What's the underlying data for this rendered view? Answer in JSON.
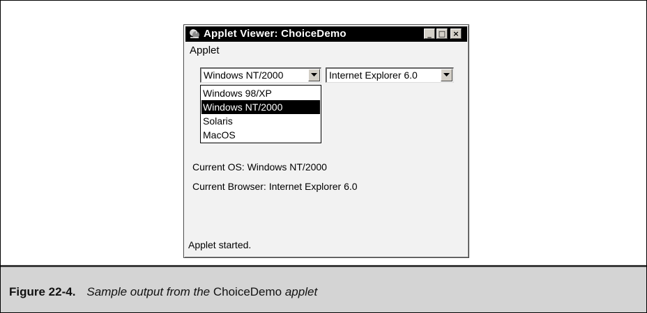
{
  "window": {
    "title": "Applet Viewer: ChoiceDemo",
    "menu": [
      "Applet"
    ],
    "controls": {
      "minimize": "_",
      "maximize": "□",
      "close": "×"
    }
  },
  "os_choice": {
    "selected": "Windows NT/2000",
    "options": [
      "Windows 98/XP",
      "Windows NT/2000",
      "Solaris",
      "MacOS"
    ],
    "highlighted": "Windows NT/2000"
  },
  "browser_choice": {
    "selected": "Internet Explorer 6.0"
  },
  "status": {
    "current_os": "Current OS: Windows NT/2000",
    "current_browser": "Current Browser: Internet Explorer 6.0",
    "applet_status": "Applet started."
  },
  "caption": {
    "figure": "Figure  22-4.",
    "text_1": "Sample output from the ",
    "text_2": "ChoiceDemo",
    "text_3": " applet"
  },
  "icons": [
    "java-applet-icon",
    "minimize-icon",
    "maximize-icon",
    "close-icon",
    "chevron-down-icon"
  ]
}
